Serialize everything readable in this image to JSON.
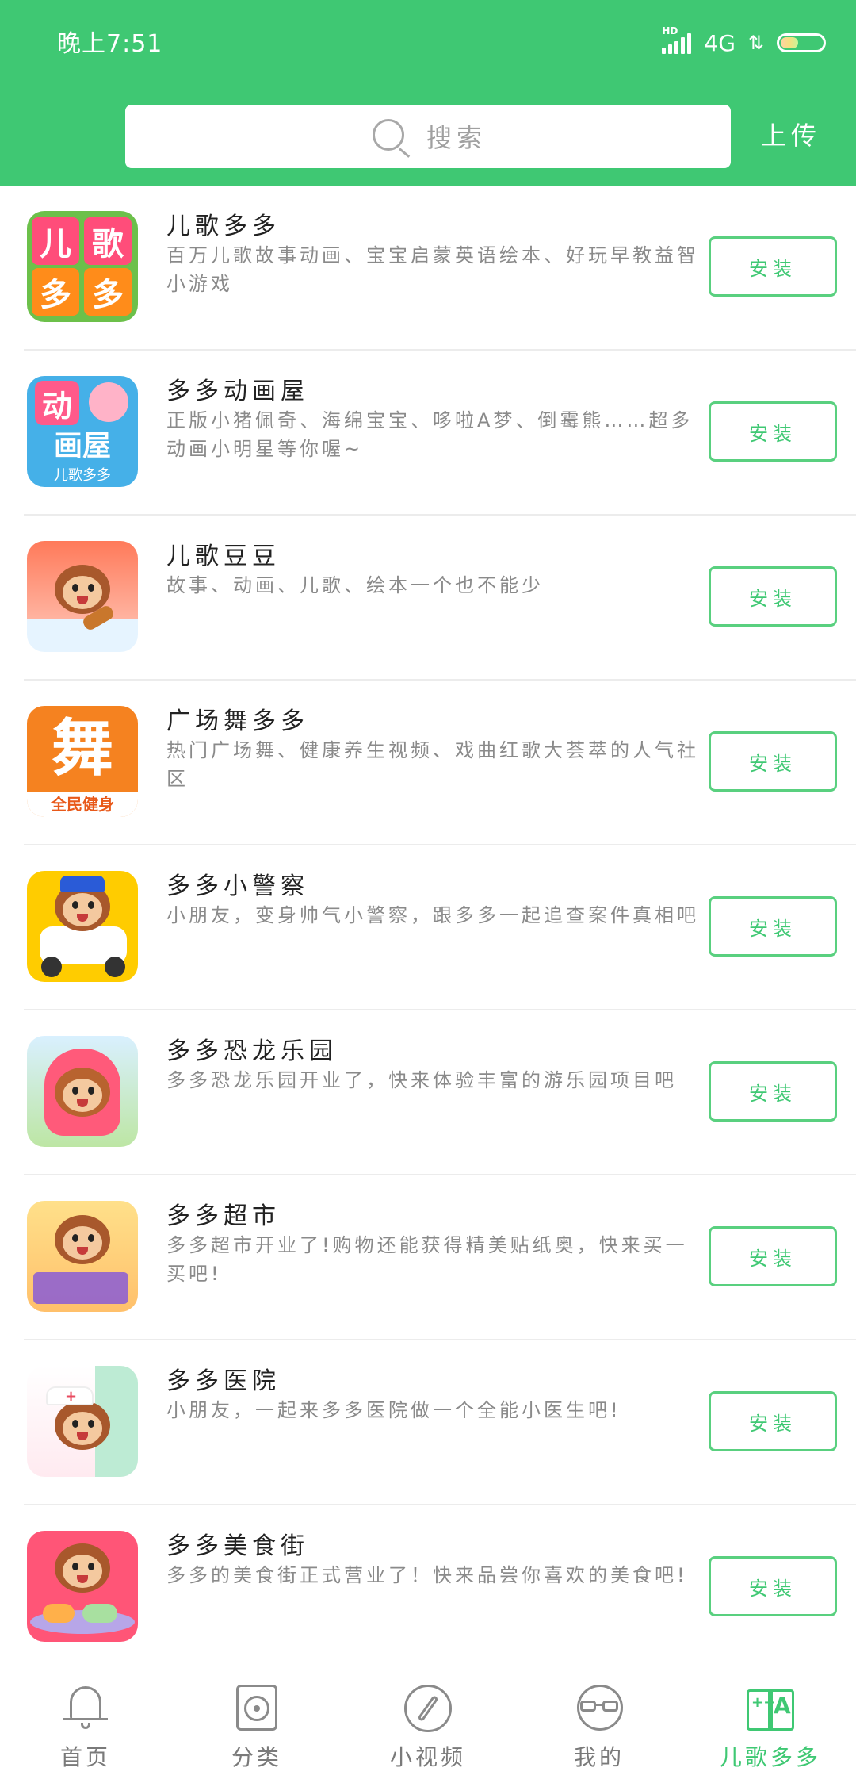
{
  "status_bar": {
    "time": "晚上7:51",
    "network": "4G",
    "hd": "HD"
  },
  "header": {
    "search_placeholder": "搜索",
    "upload_label": "上传"
  },
  "apps": [
    {
      "title": "儿歌多多",
      "desc": "百万儿歌故事动画、宝宝启蒙英语绘本、好玩早教益智小游戏",
      "install": "安装",
      "icon_text": [
        "儿",
        "歌",
        "多",
        "多"
      ]
    },
    {
      "title": "多多动画屋",
      "desc": "正版小猪佩奇、海绵宝宝、哆啦A梦、倒霉熊……超多动画小明星等你喔~",
      "install": "安装",
      "icon_text": [
        "动",
        "画屋",
        "儿歌多多"
      ]
    },
    {
      "title": "儿歌豆豆",
      "desc": "故事、动画、儿歌、绘本一个也不能少",
      "install": "安装"
    },
    {
      "title": "广场舞多多",
      "desc": "热门广场舞、健康养生视频、戏曲红歌大荟萃的人气社区",
      "install": "安装",
      "icon_text": [
        "舞",
        "全民健身"
      ]
    },
    {
      "title": "多多小警察",
      "desc": "小朋友，变身帅气小警察，跟多多一起追查案件真相吧",
      "install": "安装"
    },
    {
      "title": "多多恐龙乐园",
      "desc": "多多恐龙乐园开业了，快来体验丰富的游乐园项目吧",
      "install": "安装"
    },
    {
      "title": "多多超市",
      "desc": "多多超市开业了!购物还能获得精美贴纸奥，快来买一买吧!",
      "install": "安装"
    },
    {
      "title": "多多医院",
      "desc": "小朋友，一起来多多医院做一个全能小医生吧!",
      "install": "安装"
    },
    {
      "title": "多多美食街",
      "desc": "多多的美食街正式营业了！快来品尝你喜欢的美食吧!",
      "install": "安装"
    }
  ],
  "bottom_nav": [
    {
      "label": "首页",
      "icon": "bell-icon"
    },
    {
      "label": "分类",
      "icon": "disc-icon"
    },
    {
      "label": "小视频",
      "icon": "compass-icon"
    },
    {
      "label": "我的",
      "icon": "face-icon"
    },
    {
      "label": "儿歌多多",
      "icon": "book-icon",
      "active": true
    }
  ],
  "colors": {
    "brand_green": "#3fc873",
    "button_border": "#59d07f",
    "text_gray": "#8a8a8a"
  }
}
